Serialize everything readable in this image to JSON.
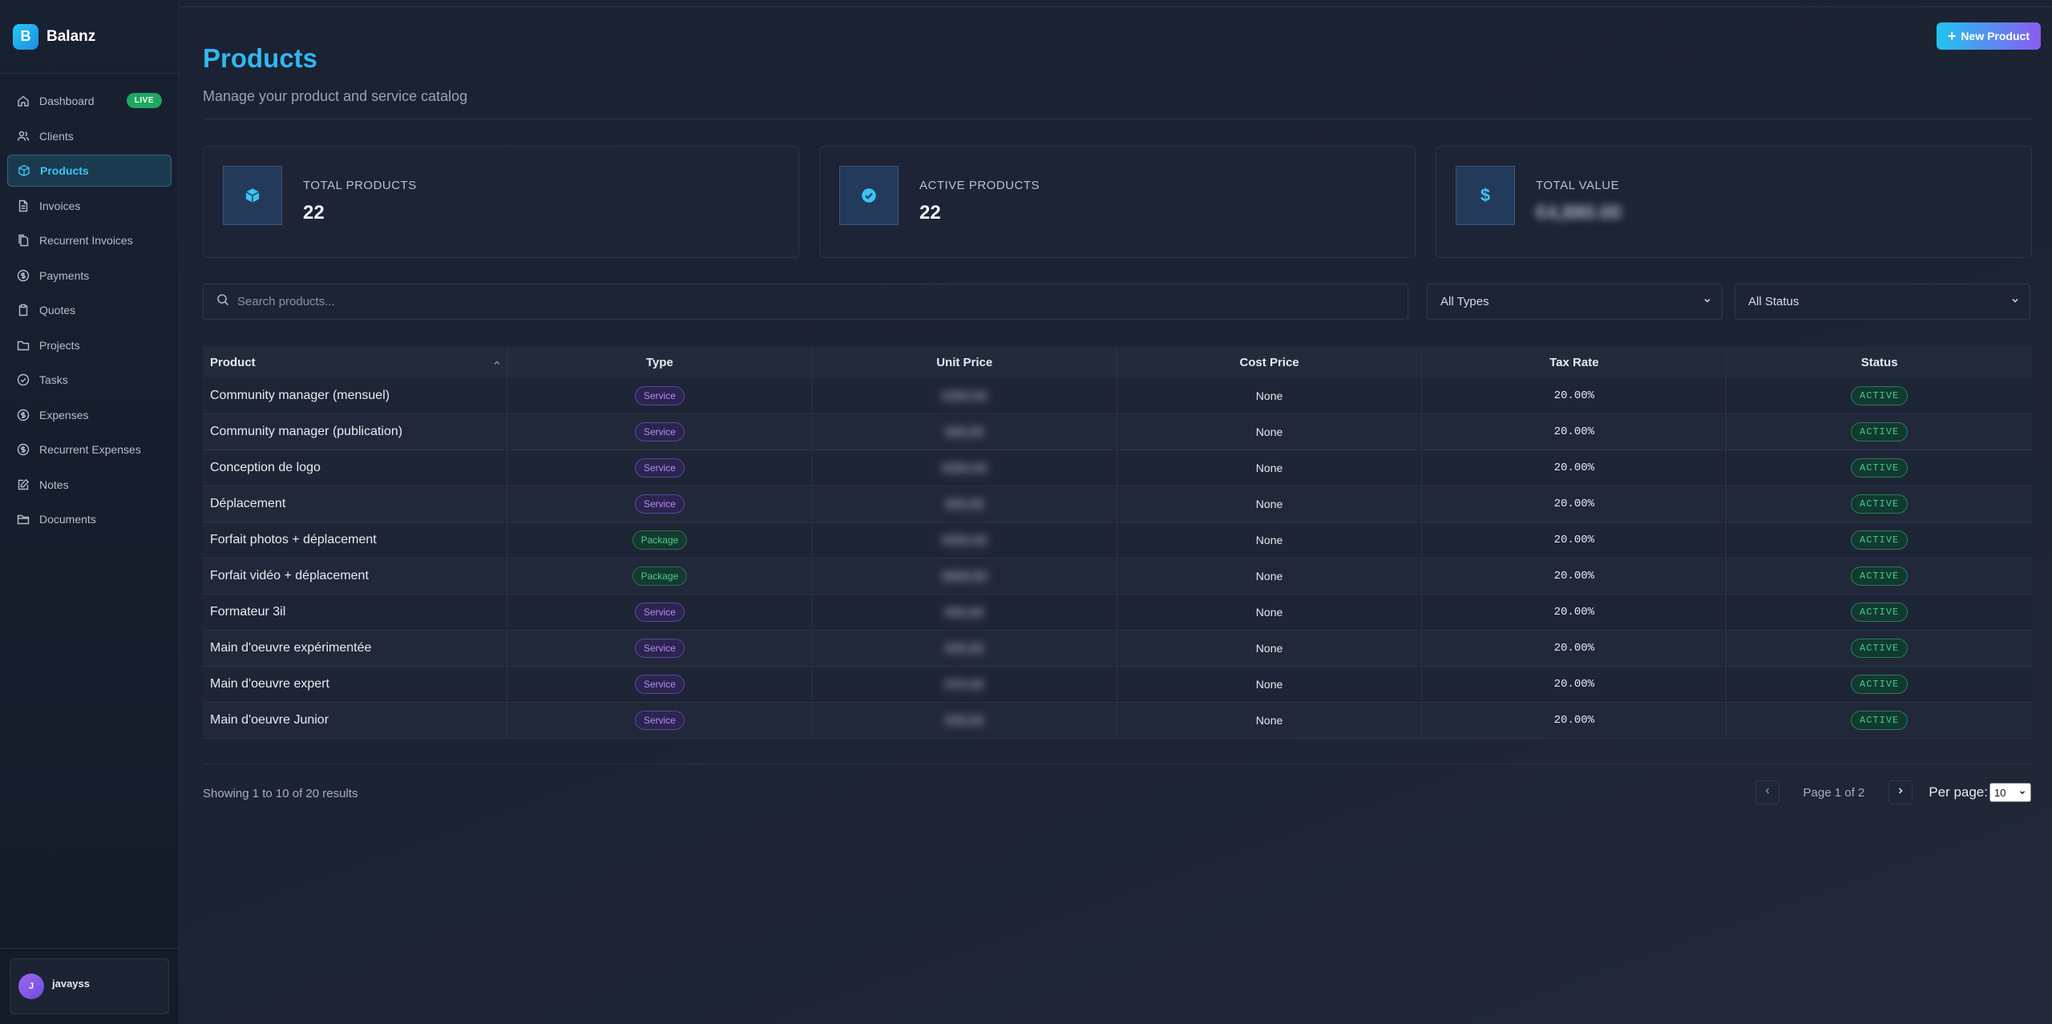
{
  "brand": {
    "logo_letter": "B",
    "name": "Balanz"
  },
  "sidebar": {
    "items": [
      {
        "label": "Dashboard",
        "badge": "LIVE"
      },
      {
        "label": "Clients"
      },
      {
        "label": "Products"
      },
      {
        "label": "Invoices"
      },
      {
        "label": "Recurrent Invoices"
      },
      {
        "label": "Payments"
      },
      {
        "label": "Quotes"
      },
      {
        "label": "Projects"
      },
      {
        "label": "Tasks"
      },
      {
        "label": "Expenses"
      },
      {
        "label": "Recurrent Expenses"
      },
      {
        "label": "Notes"
      },
      {
        "label": "Documents"
      }
    ],
    "user": {
      "initial": "J",
      "name": "javayss"
    }
  },
  "header": {
    "title": "Products",
    "subtitle": "Manage your product and service catalog",
    "new_button": "New Product"
  },
  "stats": [
    {
      "label": "TOTAL PRODUCTS",
      "value": "22"
    },
    {
      "label": "ACTIVE PRODUCTS",
      "value": "22"
    },
    {
      "label": "TOTAL VALUE",
      "value": "€4,880.00"
    }
  ],
  "filters": {
    "search_placeholder": "Search products...",
    "type_select": "All Types",
    "status_select": "All Status"
  },
  "table": {
    "columns": [
      "Product",
      "Type",
      "Unit Price",
      "Cost Price",
      "Tax Rate",
      "Status"
    ],
    "rows": [
      {
        "product": "Community manager (mensuel)",
        "type": "Service",
        "unit_price": "€350.00",
        "cost_price": "None",
        "tax_rate": "20.00%",
        "status": "ACTIVE"
      },
      {
        "product": "Community manager (publication)",
        "type": "Service",
        "unit_price": "€60.00",
        "cost_price": "None",
        "tax_rate": "20.00%",
        "status": "ACTIVE"
      },
      {
        "product": "Conception de logo",
        "type": "Service",
        "unit_price": "€300.00",
        "cost_price": "None",
        "tax_rate": "20.00%",
        "status": "ACTIVE"
      },
      {
        "product": "Déplacement",
        "type": "Service",
        "unit_price": "€50.00",
        "cost_price": "None",
        "tax_rate": "20.00%",
        "status": "ACTIVE"
      },
      {
        "product": "Forfait photos + déplacement",
        "type": "Package",
        "unit_price": "€450.00",
        "cost_price": "None",
        "tax_rate": "20.00%",
        "status": "ACTIVE"
      },
      {
        "product": "Forfait vidéo + déplacement",
        "type": "Package",
        "unit_price": "€600.00",
        "cost_price": "None",
        "tax_rate": "20.00%",
        "status": "ACTIVE"
      },
      {
        "product": "Formateur 3il",
        "type": "Service",
        "unit_price": "€60.00",
        "cost_price": "None",
        "tax_rate": "20.00%",
        "status": "ACTIVE"
      },
      {
        "product": "Main d'oeuvre expérimentée",
        "type": "Service",
        "unit_price": "€45.00",
        "cost_price": "None",
        "tax_rate": "20.00%",
        "status": "ACTIVE"
      },
      {
        "product": "Main d'oeuvre expert",
        "type": "Service",
        "unit_price": "€70.00",
        "cost_price": "None",
        "tax_rate": "20.00%",
        "status": "ACTIVE"
      },
      {
        "product": "Main d'oeuvre Junior",
        "type": "Service",
        "unit_price": "€30.00",
        "cost_price": "None",
        "tax_rate": "20.00%",
        "status": "ACTIVE"
      }
    ]
  },
  "footer": {
    "showing": "Showing 1 to 10 of 20 results",
    "page_text": "Page 1 of 2",
    "per_page_label": "Per page:",
    "per_page_value": "10"
  },
  "colors": {
    "accent": "#33b6f0",
    "brand_gradient_start": "#22c3f0",
    "brand_gradient_end": "#8a5cf0",
    "live_badge": "#1ea85f",
    "active_badge": "#3fcf8e",
    "service_badge": "#b48af5",
    "package_badge": "#45d08a"
  }
}
